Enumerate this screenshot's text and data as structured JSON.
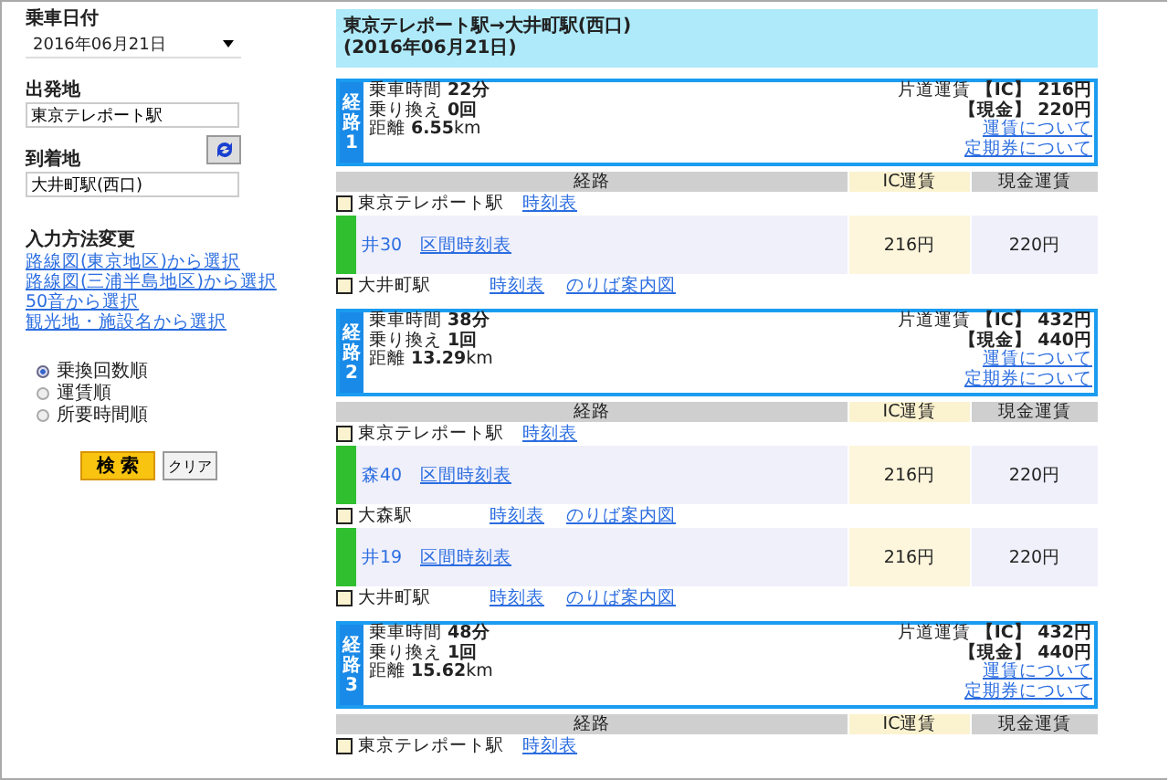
{
  "form": {
    "date_label": "乗車日付",
    "date_value": "2016年06月21日",
    "departure_label": "出発地",
    "departure_value": "東京テレポート駅",
    "arrival_label": "到着地",
    "arrival_value": "大井町駅(西口)",
    "input_method_title": "入力方法変更",
    "input_method_links": [
      "路線図(東京地区)から選択",
      "路線図(三浦半島地区)から選択",
      "50音から選択",
      "観光地・施設名から選択"
    ],
    "sort_options": [
      {
        "label": "乗換回数順",
        "selected": true
      },
      {
        "label": "運賃順",
        "selected": false
      },
      {
        "label": "所要時間順",
        "selected": false
      }
    ],
    "search_button": "検 索",
    "clear_button": "クリア"
  },
  "results": {
    "title": "東京テレポート駅→大井町駅(西口)",
    "date": "(2016年06月21日)",
    "routes": [
      {
        "badge": "経路",
        "number": "1",
        "summary": [
          "乗車時間 **22分**",
          "乗り換え **0回**",
          "距離 **6.55**km"
        ],
        "fares": [
          "片道運賃 **【IC】 216円**",
          "**【現金】 220円**"
        ],
        "links": [
          "運賃について",
          "定期券について"
        ],
        "columns": [
          "経路",
          "IC運賃",
          "現金運賃"
        ],
        "steps": [
          {
            "kind": "stop",
            "name": "東京テレポート駅",
            "links": [
              "時刻表"
            ]
          },
          {
            "kind": "segment",
            "line": "井30",
            "link": "区間時刻表",
            "ic_fare": "216円",
            "cash_fare": "220円"
          },
          {
            "kind": "stop",
            "name": "大井町駅",
            "links": [
              "時刻表",
              "のりば案内図"
            ]
          }
        ]
      },
      {
        "badge": "経路",
        "number": "2",
        "summary": [
          "乗車時間 **38分**",
          "乗り換え **1回**",
          "距離 **13.29**km"
        ],
        "fares": [
          "片道運賃 **【IC】 432円**",
          "**【現金】 440円**"
        ],
        "links": [
          "運賃について",
          "定期券について"
        ],
        "columns": [
          "経路",
          "IC運賃",
          "現金運賃"
        ],
        "steps": [
          {
            "kind": "stop",
            "name": "東京テレポート駅",
            "links": [
              "時刻表"
            ]
          },
          {
            "kind": "segment",
            "line": "森40",
            "link": "区間時刻表",
            "ic_fare": "216円",
            "cash_fare": "220円"
          },
          {
            "kind": "stop",
            "name": "大森駅",
            "links": [
              "時刻表",
              "のりば案内図"
            ]
          },
          {
            "kind": "segment",
            "line": "井19",
            "link": "区間時刻表",
            "ic_fare": "216円",
            "cash_fare": "220円"
          },
          {
            "kind": "stop",
            "name": "大井町駅",
            "links": [
              "時刻表",
              "のりば案内図"
            ]
          }
        ]
      },
      {
        "badge": "経路",
        "number": "3",
        "summary": [
          "乗車時間 **48分**",
          "乗り換え **1回**",
          "距離 **15.62**km"
        ],
        "fares": [
          "片道運賃 **【IC】 432円**",
          "**【現金】 440円**"
        ],
        "links": [
          "運賃について",
          "定期券について"
        ],
        "columns": [
          "経路",
          "IC運賃",
          "現金運賃"
        ],
        "steps": [
          {
            "kind": "stop",
            "name": "東京テレポート駅",
            "links": [
              "時刻表"
            ]
          }
        ]
      }
    ]
  }
}
